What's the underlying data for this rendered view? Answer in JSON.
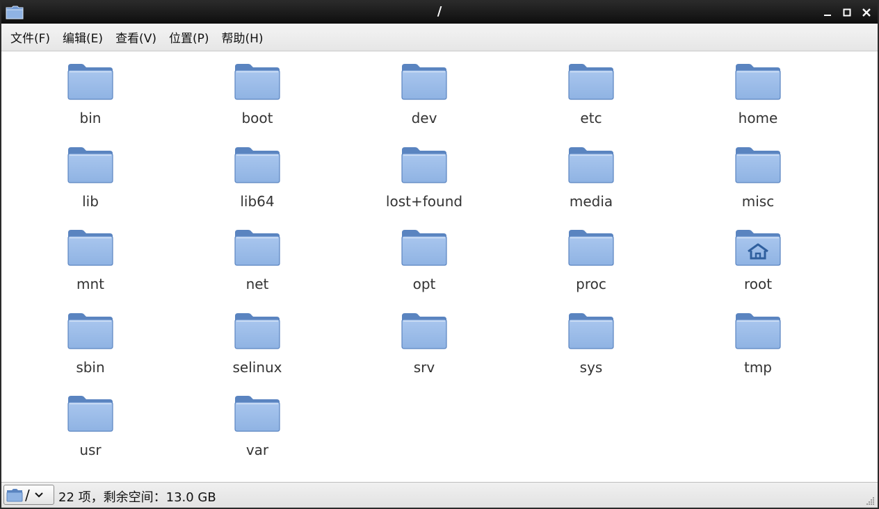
{
  "window": {
    "title": "/"
  },
  "menu": [
    {
      "label": "文件(F)"
    },
    {
      "label": "编辑(E)"
    },
    {
      "label": "查看(V)"
    },
    {
      "label": "位置(P)"
    },
    {
      "label": "帮助(H)"
    }
  ],
  "folders": [
    {
      "name": "bin",
      "icon": "folder-icon"
    },
    {
      "name": "boot",
      "icon": "folder-icon"
    },
    {
      "name": "dev",
      "icon": "folder-icon"
    },
    {
      "name": "etc",
      "icon": "folder-icon"
    },
    {
      "name": "home",
      "icon": "folder-icon"
    },
    {
      "name": "lib",
      "icon": "folder-icon"
    },
    {
      "name": "lib64",
      "icon": "folder-icon"
    },
    {
      "name": "lost+found",
      "icon": "folder-icon"
    },
    {
      "name": "media",
      "icon": "folder-icon"
    },
    {
      "name": "misc",
      "icon": "folder-icon"
    },
    {
      "name": "mnt",
      "icon": "folder-icon"
    },
    {
      "name": "net",
      "icon": "folder-icon"
    },
    {
      "name": "opt",
      "icon": "folder-icon"
    },
    {
      "name": "proc",
      "icon": "folder-icon"
    },
    {
      "name": "root",
      "icon": "home-folder-icon"
    },
    {
      "name": "sbin",
      "icon": "folder-icon"
    },
    {
      "name": "selinux",
      "icon": "folder-icon"
    },
    {
      "name": "srv",
      "icon": "folder-icon"
    },
    {
      "name": "sys",
      "icon": "folder-icon"
    },
    {
      "name": "tmp",
      "icon": "folder-icon"
    },
    {
      "name": "usr",
      "icon": "folder-icon"
    },
    {
      "name": "var",
      "icon": "folder-icon"
    }
  ],
  "statusbar": {
    "location": "/",
    "summary": "22 项，剩余空间：13.0 GB"
  },
  "colors": {
    "folder_body": "#8fb3e3",
    "folder_dark": "#5a84c0",
    "titlebar": "#1a1a1a"
  }
}
